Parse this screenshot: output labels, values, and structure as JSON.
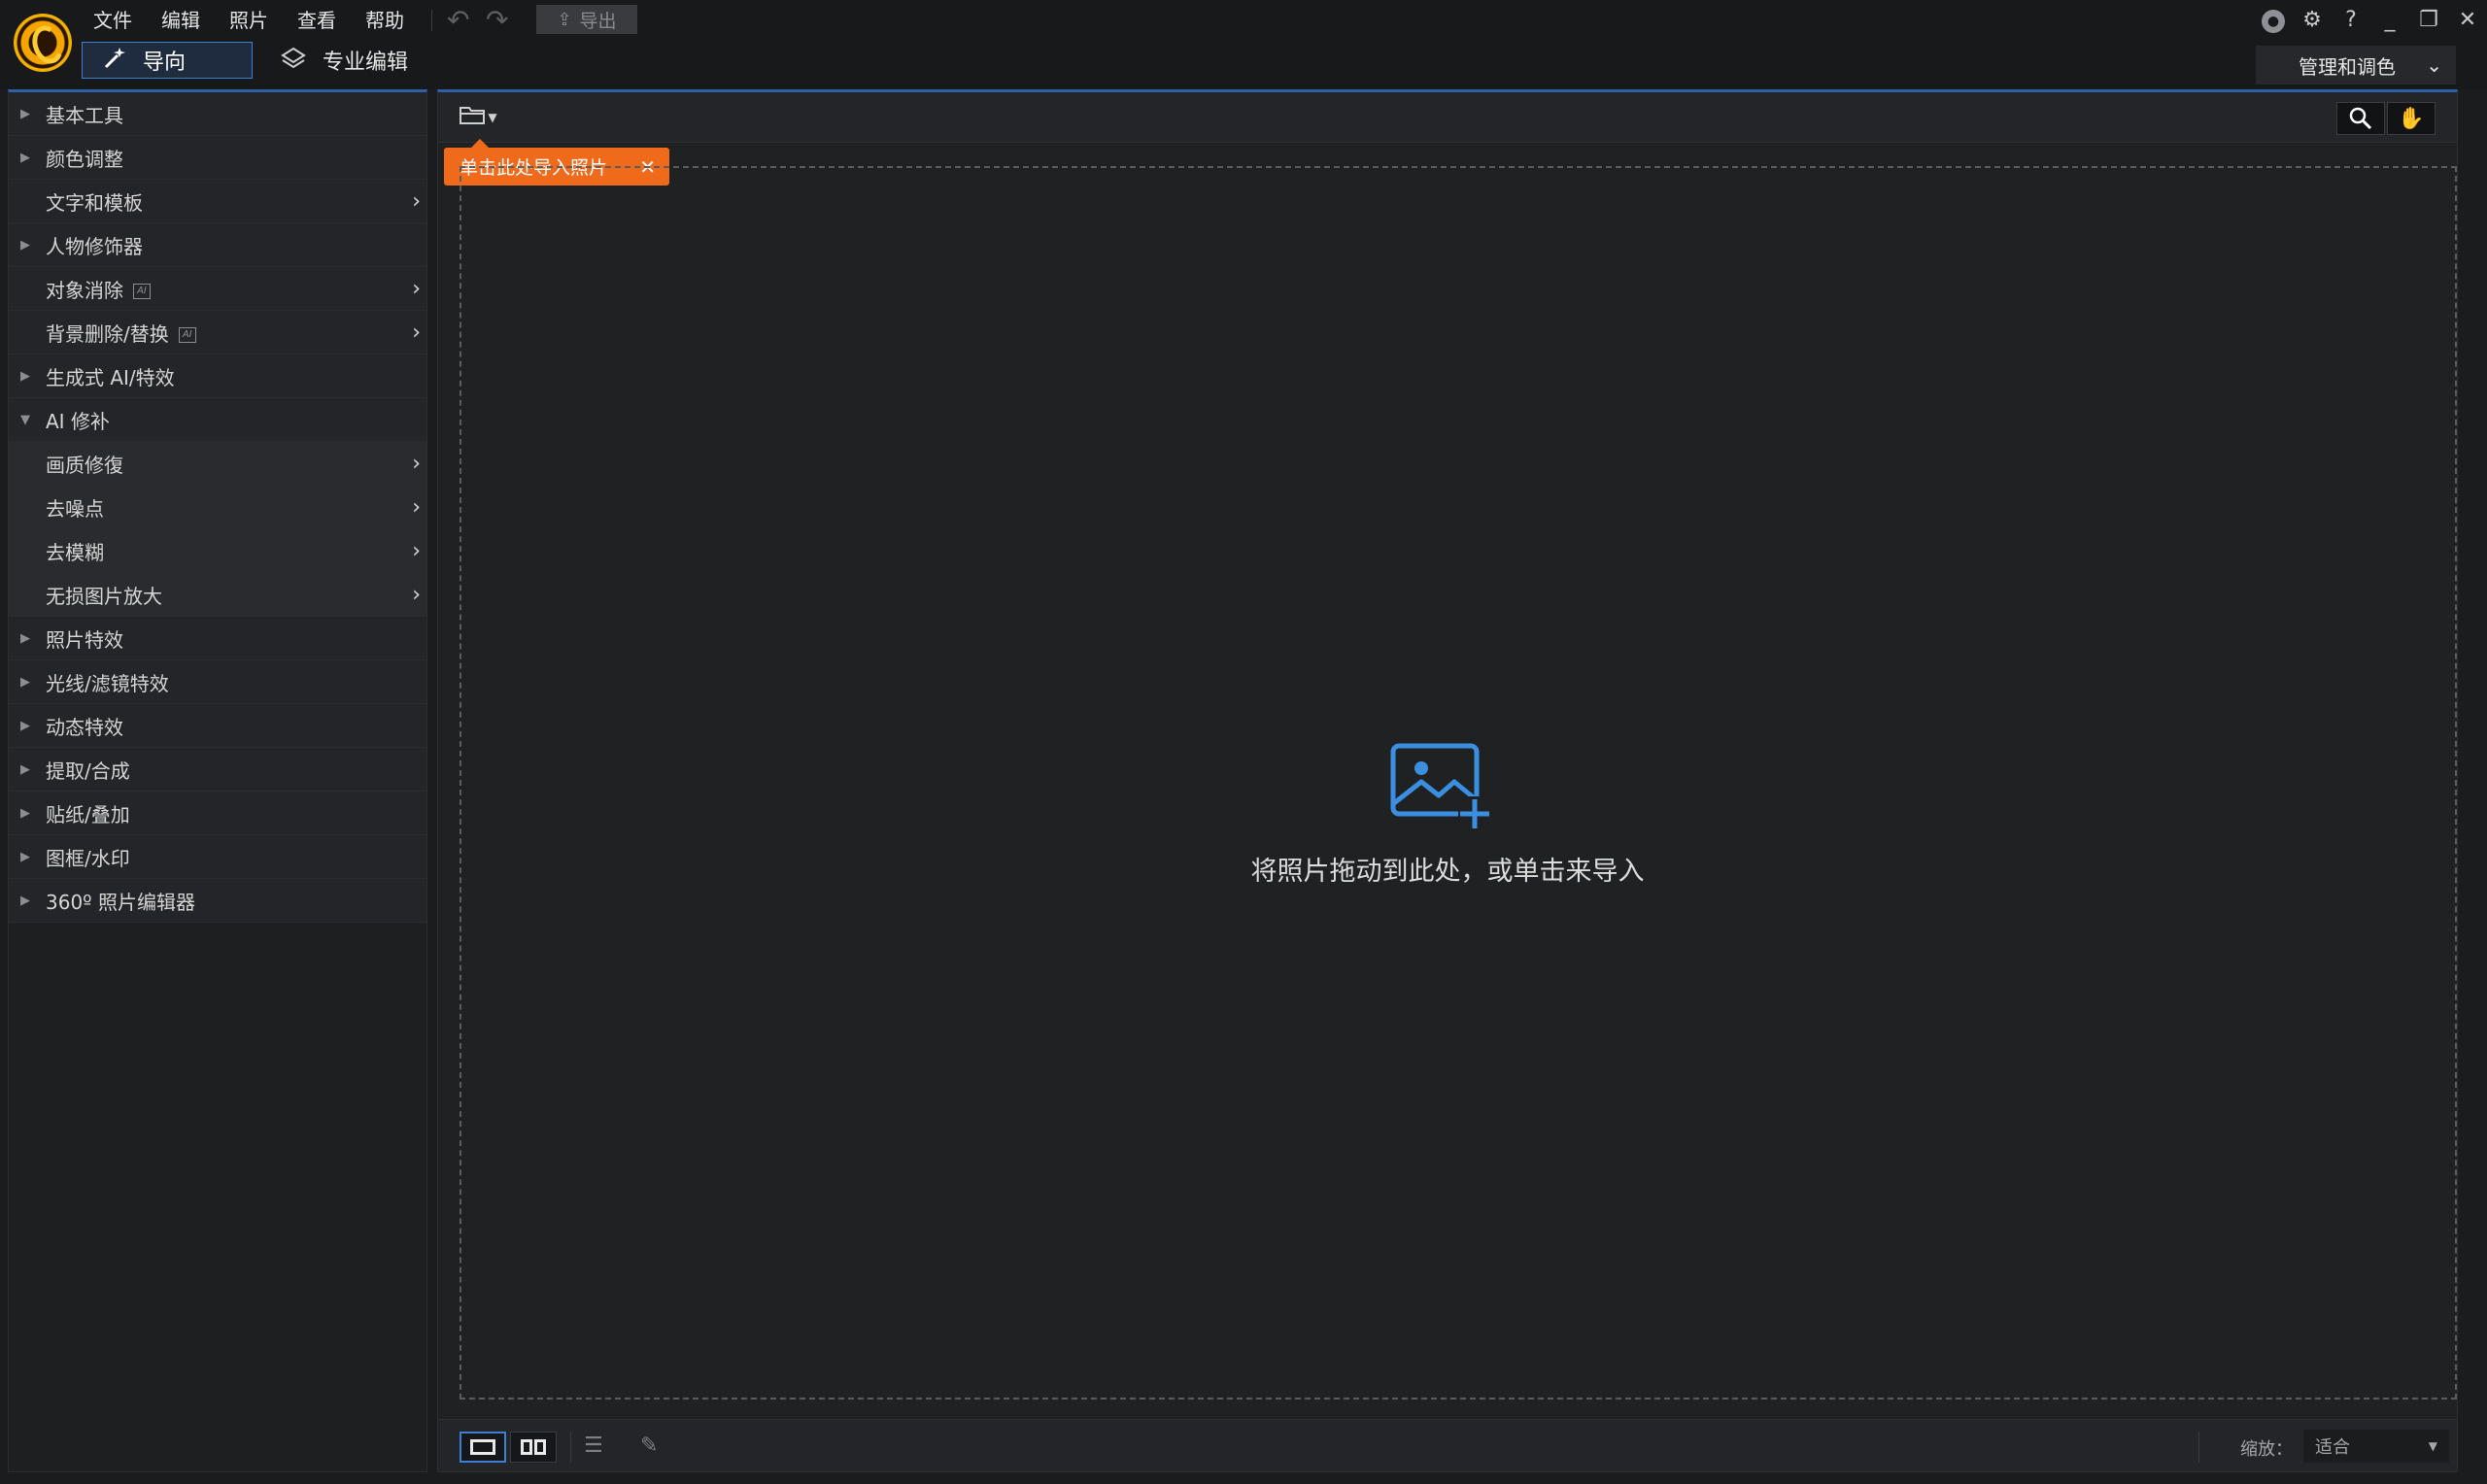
{
  "menu": [
    "文件",
    "编辑",
    "照片",
    "查看",
    "帮助"
  ],
  "toolbar": {
    "export_label": "导出",
    "export_icon": "⇪"
  },
  "modes": {
    "guide_label": "导向",
    "pro_label": "专业编辑"
  },
  "manage_label": "管理和调色",
  "sidebar": {
    "items": [
      {
        "label": "基本工具",
        "type": "collapsed"
      },
      {
        "label": "颜色调整",
        "type": "collapsed"
      },
      {
        "label": "文字和模板",
        "type": "link"
      },
      {
        "label": "人物修饰器",
        "type": "collapsed"
      },
      {
        "label": "对象消除",
        "type": "link",
        "ai": true
      },
      {
        "label": "背景删除/替换",
        "type": "link",
        "ai": true
      },
      {
        "label": "生成式 AI/特效",
        "type": "collapsed"
      },
      {
        "label": "AI 修补",
        "type": "expanded"
      },
      {
        "label": "画质修復",
        "type": "sub"
      },
      {
        "label": "去噪点",
        "type": "sub"
      },
      {
        "label": "去模糊",
        "type": "sub"
      },
      {
        "label": "无损图片放大",
        "type": "sub"
      },
      {
        "label": "照片特效",
        "type": "collapsed"
      },
      {
        "label": "光线/滤镜特效",
        "type": "collapsed"
      },
      {
        "label": "动态特效",
        "type": "collapsed"
      },
      {
        "label": "提取/合成",
        "type": "collapsed"
      },
      {
        "label": "贴纸/叠加",
        "type": "collapsed"
      },
      {
        "label": "图框/水印",
        "type": "collapsed"
      },
      {
        "label": "360º 照片编辑器",
        "type": "collapsed"
      }
    ]
  },
  "main": {
    "tooltip": "单击此处导入照片",
    "drop_text": "将照片拖动到此处，或单击来导入"
  },
  "bottom": {
    "zoom_label": "缩放：",
    "zoom_value": "适合"
  },
  "colors": {
    "accent": "#3e7fd0",
    "tooltip": "#ef6a1a",
    "drop_icon": "#3a8fe0"
  }
}
